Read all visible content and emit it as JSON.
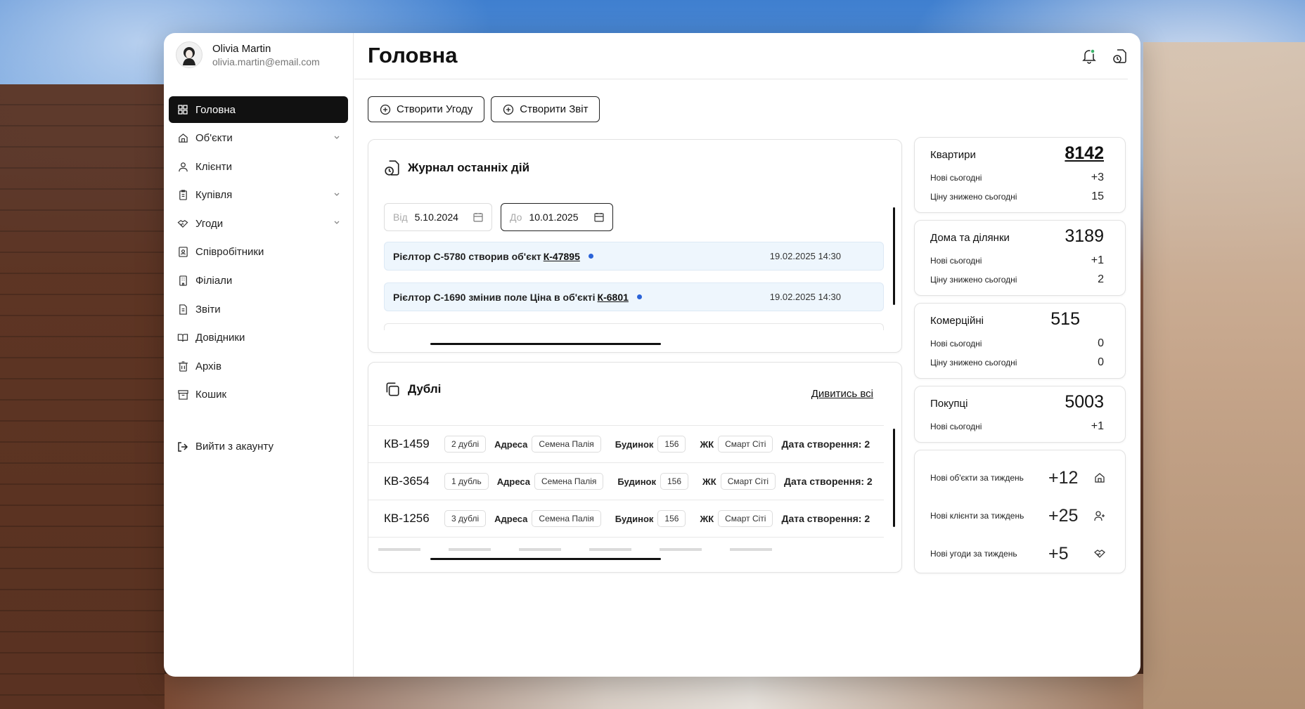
{
  "user": {
    "name": "Olivia Martin",
    "email": "olivia.martin@email.com"
  },
  "nav": [
    {
      "label": "Головна",
      "icon": "grid-icon",
      "active": true
    },
    {
      "label": "Об'єкти",
      "icon": "home-icon",
      "chevron": true
    },
    {
      "label": "Клієнти",
      "icon": "user-icon"
    },
    {
      "label": "Купівля",
      "icon": "clipboard-icon",
      "chevron": true
    },
    {
      "label": "Угоди",
      "icon": "handshake-icon",
      "chevron": true
    },
    {
      "label": "Співробітники",
      "icon": "badge-icon"
    },
    {
      "label": "Філіали",
      "icon": "building-icon"
    },
    {
      "label": "Звіти",
      "icon": "report-icon"
    },
    {
      "label": "Довідники",
      "icon": "book-icon"
    },
    {
      "label": "Архів",
      "icon": "archive-icon"
    },
    {
      "label": "Кошик",
      "icon": "trash-icon"
    }
  ],
  "logout": "Вийти з акаунту",
  "header": {
    "title": "Головна"
  },
  "actions": {
    "create_deal": "Створити Угоду",
    "create_report": "Створити Звіт"
  },
  "log": {
    "title": "Журнал останніх дій",
    "from_label": "Від",
    "from_value": "5.10.2024",
    "to_label": "До",
    "to_value": "10.01.2025",
    "rows": [
      {
        "text": "Рієлтор С-5780 створив об'єкт",
        "link": "К-47895",
        "time": "19.02.2025 14:30"
      },
      {
        "text": "Рієлтор С-1690 змінив поле Ціна в об'єкті",
        "link": "К-6801",
        "time": "19.02.2025 14:30"
      }
    ]
  },
  "dups": {
    "title": "Дублі",
    "view_all": "Дивитись всі",
    "address_label": "Адреса",
    "house_label": "Будинок",
    "complex_label": "ЖК",
    "created_label": "Дата створення: 2",
    "rows": [
      {
        "id": "КВ-1459",
        "count": "2 дублі",
        "address": "Семена Палія",
        "house": "156",
        "complex": "Смарт Сіті"
      },
      {
        "id": "КВ-3654",
        "count": "1 дубль",
        "address": "Семена Палія",
        "house": "156",
        "complex": "Смарт Сіті"
      },
      {
        "id": "КВ-1256",
        "count": "3 дублі",
        "address": "Семена Палія",
        "house": "156",
        "complex": "Смарт Сіті"
      }
    ]
  },
  "stats": [
    {
      "name": "Квартири",
      "value": "8142",
      "rows": [
        {
          "label": "Нові сьогодні",
          "value": "+3"
        },
        {
          "label": "Ціну знижено сьогодні",
          "value": "15"
        }
      ]
    },
    {
      "name": "Дома та ділянки",
      "value": "3189",
      "rows": [
        {
          "label": "Нові сьогодні",
          "value": "+1"
        },
        {
          "label": "Ціну знижено сьогодні",
          "value": "2"
        }
      ]
    },
    {
      "name": "Комерційні",
      "value": "515",
      "rows": [
        {
          "label": "Нові сьогодні",
          "value": "0"
        },
        {
          "label": "Ціну знижено сьогодні",
          "value": "0"
        }
      ]
    },
    {
      "name": "Покупці",
      "value": "5003",
      "rows": [
        {
          "label": "Нові сьогодні",
          "value": "+1"
        }
      ]
    }
  ],
  "weekly": [
    {
      "label": "Нові об'єкти за тиждень",
      "value": "+12",
      "icon": "home-icon"
    },
    {
      "label": "Нові клієнти за тиждень",
      "value": "+25",
      "icon": "user-plus-icon"
    },
    {
      "label": "Нові угоди за тиждень",
      "value": "+5",
      "icon": "handshake-icon"
    }
  ]
}
